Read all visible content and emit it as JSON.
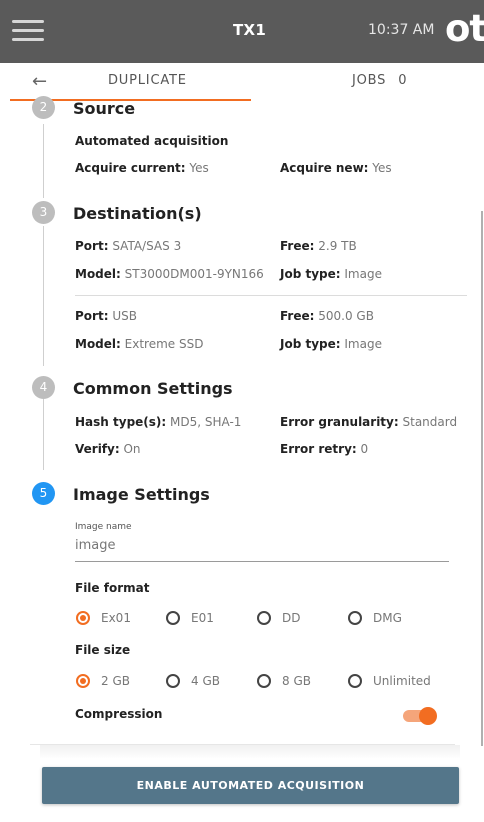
{
  "topbar": {
    "device_name": "TX1",
    "time": "10:37 AM",
    "logo_text": "ot"
  },
  "tabs": {
    "duplicate_label": "DUPLICATE",
    "jobs_label": "JOBS",
    "jobs_count": "0"
  },
  "steps": {
    "source": {
      "number": "2",
      "title": "Source",
      "subtitle": "Automated acquisition",
      "acquire_current_label": "Acquire current:",
      "acquire_current_value": "Yes",
      "acquire_new_label": "Acquire new:",
      "acquire_new_value": "Yes"
    },
    "destination": {
      "number": "3",
      "title": "Destination(s)",
      "drives": [
        {
          "port_label": "Port:",
          "port_value": "SATA/SAS 3",
          "free_label": "Free:",
          "free_value": "2.9 TB",
          "model_label": "Model:",
          "model_value": "ST3000DM001-9YN166",
          "jobtype_label": "Job type:",
          "jobtype_value": "Image"
        },
        {
          "port_label": "Port:",
          "port_value": "USB",
          "free_label": "Free:",
          "free_value": "500.0 GB",
          "model_label": "Model:",
          "model_value": "Extreme SSD",
          "jobtype_label": "Job type:",
          "jobtype_value": "Image"
        }
      ]
    },
    "common": {
      "number": "4",
      "title": "Common Settings",
      "hash_label": "Hash type(s):",
      "hash_value": "MD5, SHA-1",
      "granularity_label": "Error granularity:",
      "granularity_value": "Standard",
      "verify_label": "Verify:",
      "verify_value": "On",
      "retry_label": "Error retry:",
      "retry_value": "0"
    },
    "image": {
      "number": "5",
      "title": "Image Settings",
      "image_name_label": "Image name",
      "image_name_value": "image",
      "file_format_label": "File format",
      "file_format_options": [
        "Ex01",
        "E01",
        "DD",
        "DMG"
      ],
      "file_format_selected": "Ex01",
      "file_size_label": "File size",
      "file_size_options": [
        "2 GB",
        "4 GB",
        "8 GB",
        "Unlimited"
      ],
      "file_size_selected": "2 GB",
      "compression_label": "Compression",
      "compression_on": true
    }
  },
  "action_button_label": "ENABLE AUTOMATED ACQUISITION",
  "colors": {
    "accent": "#f26d21",
    "active_step": "#2196f3",
    "topbar": "#5a5a5a",
    "button": "#54768a"
  }
}
